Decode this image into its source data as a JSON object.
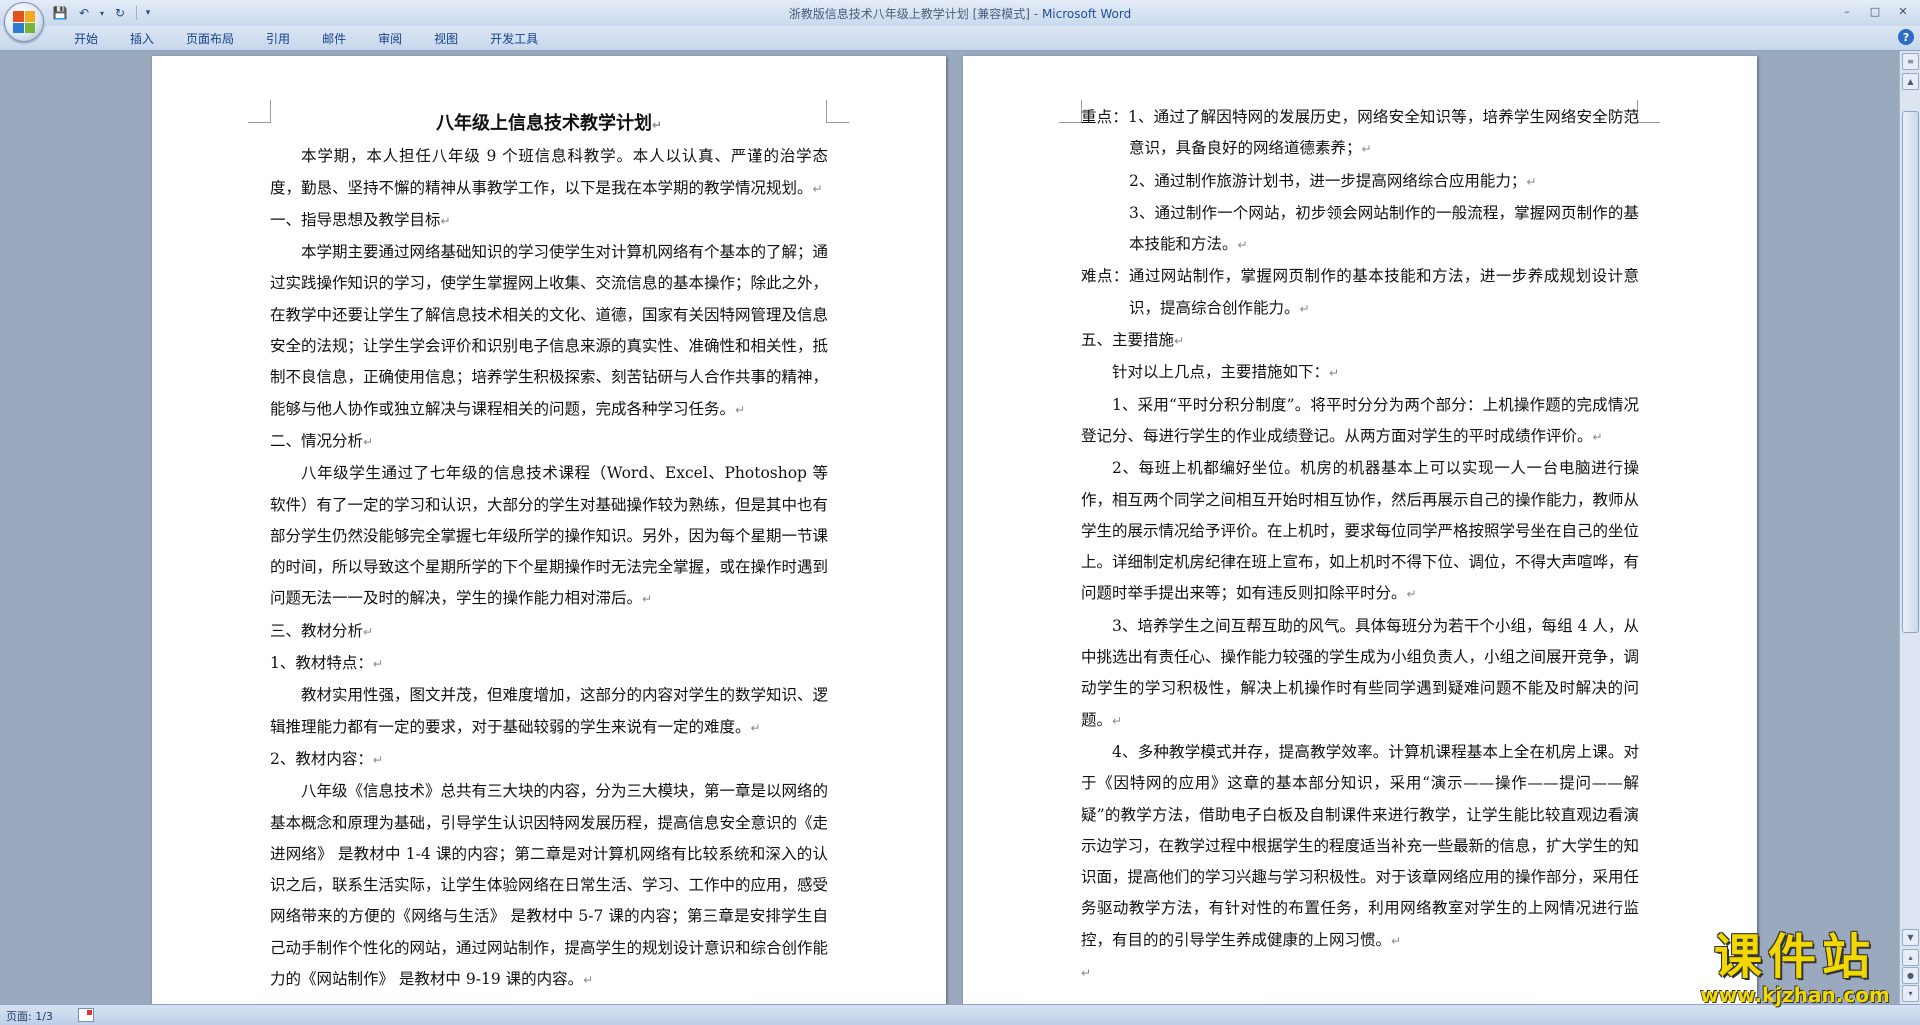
{
  "window": {
    "doc_title": "浙教版信息技术八年级上教学计划 [兼容模式]",
    "separator": " - ",
    "app_name": "Microsoft Word"
  },
  "ribbon_tabs": [
    "开始",
    "插入",
    "页面布局",
    "引用",
    "邮件",
    "审阅",
    "视图",
    "开发工具"
  ],
  "left_page": {
    "title": "八年级上信息技术教学计划",
    "intro": "本学期，本人担任八年级 9 个班信息科教学。本人以认真、严谨的治学态度，勤恳、坚持不懈的精神从事教学工作，以下是我在本学期的教学情况规划。",
    "h1": "一、指导思想及教学目标",
    "p1": "本学期主要通过网络基础知识的学习使学生对计算机网络有个基本的了解；通过实践操作知识的学习，使学生掌握网上收集、交流信息的基本操作；除此之外，在教学中还要让学生了解信息技术相关的文化、道德，国家有关因特网管理及信息安全的法规；让学生学会评价和识别电子信息来源的真实性、准确性和相关性，抵制不良信息，正确使用信息；培养学生积极探索、刻苦钻研与人合作共事的精神，能够与他人协作或独立解决与课程相关的问题，完成各种学习任务。",
    "h2": "二、情况分析",
    "p2": "八年级学生通过了七年级的信息技术课程（Word、Excel、Photoshop 等软件）有了一定的学习和认识，大部分的学生对基础操作较为熟练，但是其中也有部分学生仍然没能够完全掌握七年级所学的操作知识。另外，因为每个星期一节课的时间，所以导致这个星期所学的下个星期操作时无法完全掌握，或在操作时遇到问题无法一一及时的解决，学生的操作能力相对滞后。",
    "h3": "三、教材分析",
    "h3_1": "1、教材特点：",
    "p3": "教材实用性强，图文并茂，但难度增加，这部分的内容对学生的数学知识、逻辑推理能力都有一定的要求，对于基础较弱的学生来说有一定的难度。",
    "h3_2": "2、教材内容：",
    "p4": "八年级《信息技术》总共有三大块的内容，分为三大模块，第一章是以网络的基本概念和原理为基础，引导学生认识因特网发展历程，提高信息安全意识的《走进网络》 是教材中 1-4 课的内容；第二章是对计算机网络有比较系统和深入的认识之后，联系生活实际，让学生体验网络在日常生活、学习、工作中的应用，感受网络带来的方便的《网络与生活》 是教材中 5-7 课的内容；第三章是安排学生自己动手制作个性化的网站，通过网站制作，提高学生的规划设计意识和综合创作能力的《网站制作》 是教材中 9-19 课的内容。"
  },
  "right_page": {
    "zd1": "重点：1、通过了解因特网的发展历史，网络安全知识等，培养学生网络安全防范意识，具备良好的网络道德素养；",
    "zd2": "2、通过制作旅游计划书，进一步提高网络综合应用能力；",
    "zd3": "3、通过制作一个网站，初步领会网站制作的一般流程，掌握网页制作的基本技能和方法。",
    "nd": "难点：通过网站制作，掌握网页制作的基本技能和方法，进一步养成规划设计意识，提高综合创作能力。",
    "h5": "五、主要措施",
    "m0": "针对以上几点，主要措施如下：",
    "m1": "1、采用“平时分积分制度”。将平时分分为两个部分：上机操作题的完成情况登记分、每进行学生的作业成绩登记。从两方面对学生的平时成绩作评价。",
    "m2": "2、每班上机都编好坐位。机房的机器基本上可以实现一人一台电脑进行操作，相互两个同学之间相互开始时相互协作，然后再展示自己的操作能力，教师从学生的展示情况给予评价。在上机时，要求每位同学严格按照学号坐在自己的坐位上。详细制定机房纪律在班上宣布，如上机时不得下位、调位，不得大声喧哗，有问题时举手提出来等；如有违反则扣除平时分。",
    "m3": "3、培养学生之间互帮互助的风气。具体每班分为若干个小组，每组 4 人，从中挑选出有责任心、操作能力较强的学生成为小组负责人，小组之间展开竞争，调动学生的学习积极性，解决上机操作时有些同学遇到疑难问题不能及时解决的问题。",
    "m4": "4、多种教学模式并存，提高教学效率。计算机课程基本上全在机房上课。对于《因特网的应用》这章的基本部分知识，采用“演示——操作——提问——解疑”的教学方法，借助电子白板及自制课件来进行教学，让学生能比较直观边看演示边学习，在教学过程中根据学生的程度适当补充一些最新的信息，扩大学生的知识面，提高他们的学习兴趣与学习积极性。对于该章网络应用的操作部分，采用任务驱动教学方法，有针对性的布置任务，利用网络教室对学生的上网情况进行监控，有目的的引导学生养成健康的上网习惯。"
  },
  "status": {
    "page": "页面: 1/3"
  },
  "watermark": {
    "name": "课件站",
    "url": "www.kjzhan.com"
  }
}
